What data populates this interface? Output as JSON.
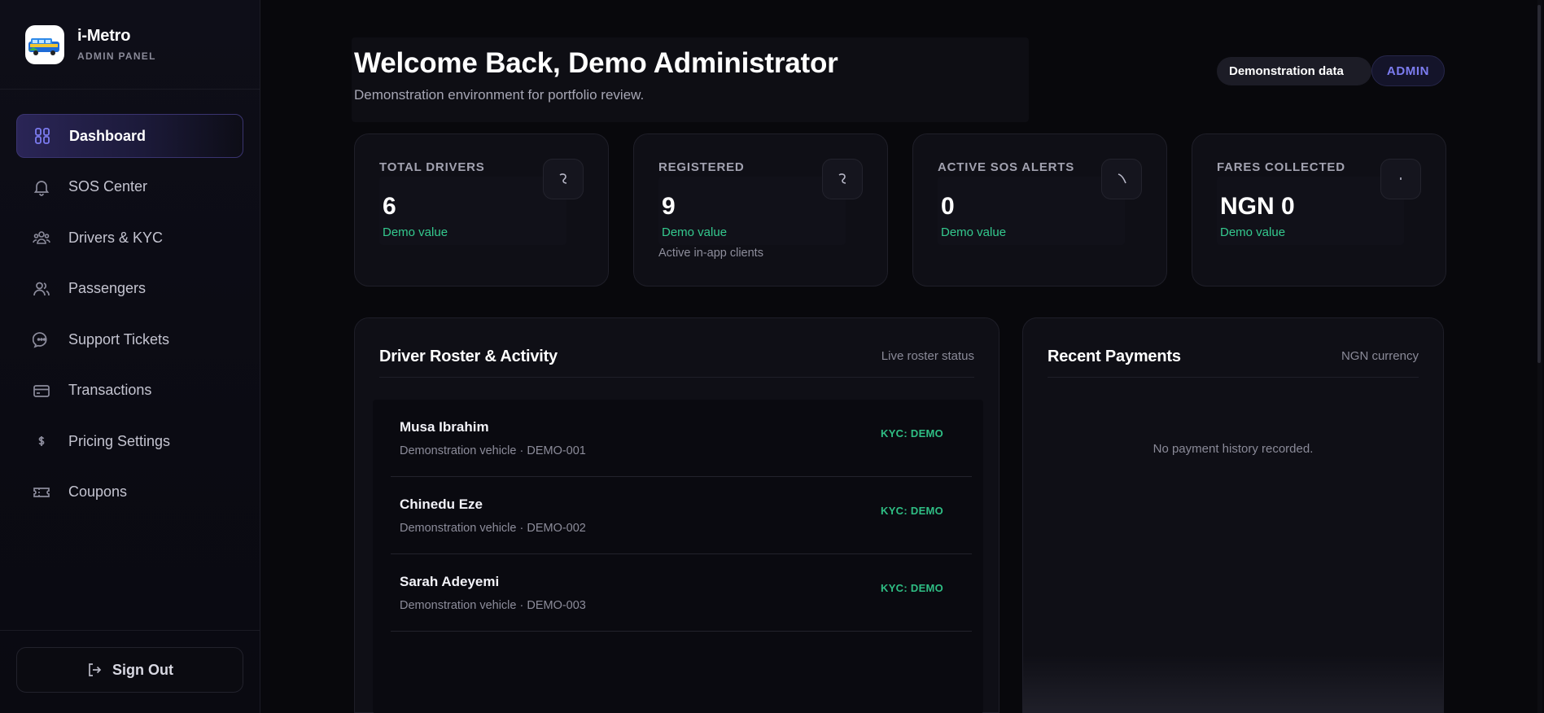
{
  "brand": {
    "name": "i-Metro",
    "subtitle": "ADMIN PANEL"
  },
  "sidebar": {
    "items": [
      {
        "label": "Dashboard",
        "icon": "grid-icon",
        "active": true
      },
      {
        "label": "SOS Center",
        "icon": "bell-icon",
        "active": false
      },
      {
        "label": "Drivers & KYC",
        "icon": "users-group-icon",
        "active": false
      },
      {
        "label": "Passengers",
        "icon": "users-icon",
        "active": false
      },
      {
        "label": "Support Tickets",
        "icon": "chat-bubble-icon",
        "active": false
      },
      {
        "label": "Transactions",
        "icon": "credit-card-icon",
        "active": false
      },
      {
        "label": "Pricing Settings",
        "icon": "dollar-icon",
        "active": false
      },
      {
        "label": "Coupons",
        "icon": "ticket-icon",
        "active": false
      }
    ],
    "sign_out": "Sign Out"
  },
  "header": {
    "title": "Welcome Back, Demo Administrator",
    "subtitle": "Demonstration environment for portfolio review.",
    "demo_badge": "Demonstration data",
    "role_badge": "ADMIN"
  },
  "stats": [
    {
      "label": "TOTAL DRIVERS",
      "value": "6",
      "note": "Demo value",
      "sub": ""
    },
    {
      "label": "REGISTERED",
      "value": "9",
      "note": "Demo value",
      "sub": "Active in-app clients"
    },
    {
      "label": "ACTIVE SOS ALERTS",
      "value": "0",
      "note": "Demo value",
      "sub": ""
    },
    {
      "label": "FARES COLLECTED",
      "value": "NGN 0",
      "note": "Demo value",
      "sub": ""
    }
  ],
  "roster": {
    "title": "Driver Roster & Activity",
    "meta": "Live roster status",
    "rows": [
      {
        "name": "Musa Ibrahim",
        "vehicle": "Demonstration vehicle · DEMO-001",
        "kyc": "KYC: DEMO"
      },
      {
        "name": "Chinedu Eze",
        "vehicle": "Demonstration vehicle · DEMO-002",
        "kyc": "KYC: DEMO"
      },
      {
        "name": "Sarah Adeyemi",
        "vehicle": "Demonstration vehicle · DEMO-003",
        "kyc": "KYC: DEMO"
      }
    ]
  },
  "payments": {
    "title": "Recent Payments",
    "meta": "NGN currency",
    "empty": "No payment history recorded."
  },
  "colors": {
    "accent": "#7c7cf0",
    "success": "#2fbe84",
    "background": "#08080c"
  }
}
